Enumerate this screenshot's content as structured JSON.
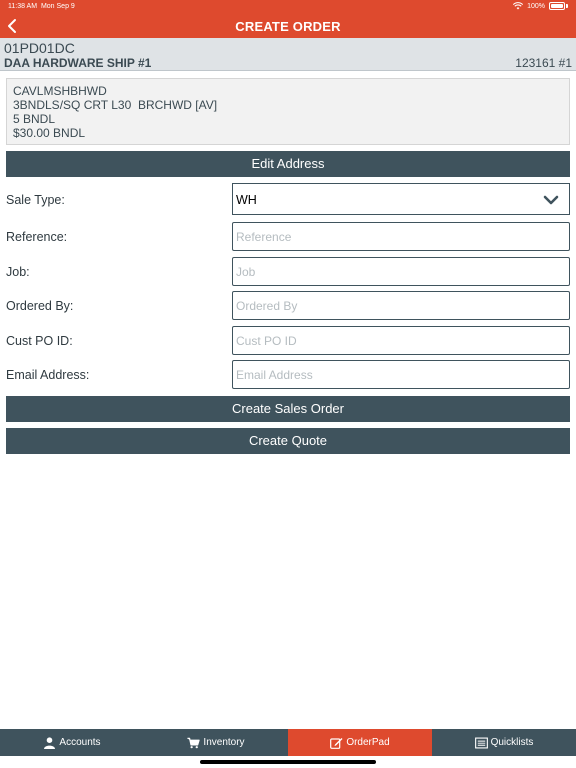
{
  "status_bar": {
    "time": "11:38 AM",
    "date": "Mon Sep 9",
    "battery": "100%"
  },
  "nav": {
    "title": "CREATE ORDER"
  },
  "account": {
    "code": "01PD01DC",
    "name": "DAA HARDWARE SHIP #1",
    "number": "123161 #1"
  },
  "item": {
    "code": "CAVLMSHBHWD",
    "description": "3BNDLS/SQ CRT L30  BRCHWD [AV]",
    "quantity": "5 BNDL",
    "price": "$30.00 BNDL"
  },
  "buttons": {
    "edit_address": "Edit Address",
    "create_sales_order": "Create Sales Order",
    "create_quote": "Create Quote"
  },
  "form": {
    "sale_type": {
      "label": "Sale Type:",
      "value": "WH"
    },
    "reference": {
      "label": "Reference:",
      "placeholder": "Reference"
    },
    "job": {
      "label": "Job:",
      "placeholder": "Job"
    },
    "ordered_by": {
      "label": "Ordered By:",
      "placeholder": "Ordered By"
    },
    "cust_po": {
      "label": "Cust PO ID:",
      "placeholder": "Cust PO ID"
    },
    "email": {
      "label": "Email Address:",
      "placeholder": "Email Address"
    }
  },
  "tabs": [
    {
      "label": "Accounts",
      "icon": "person-icon"
    },
    {
      "label": "Inventory",
      "icon": "cart-icon"
    },
    {
      "label": "OrderPad",
      "icon": "edit-icon"
    },
    {
      "label": "Quicklists",
      "icon": "list-icon"
    }
  ],
  "colors": {
    "accent": "#de4a2e",
    "slate": "#3f535d",
    "header_bg": "#dfe3e6"
  }
}
